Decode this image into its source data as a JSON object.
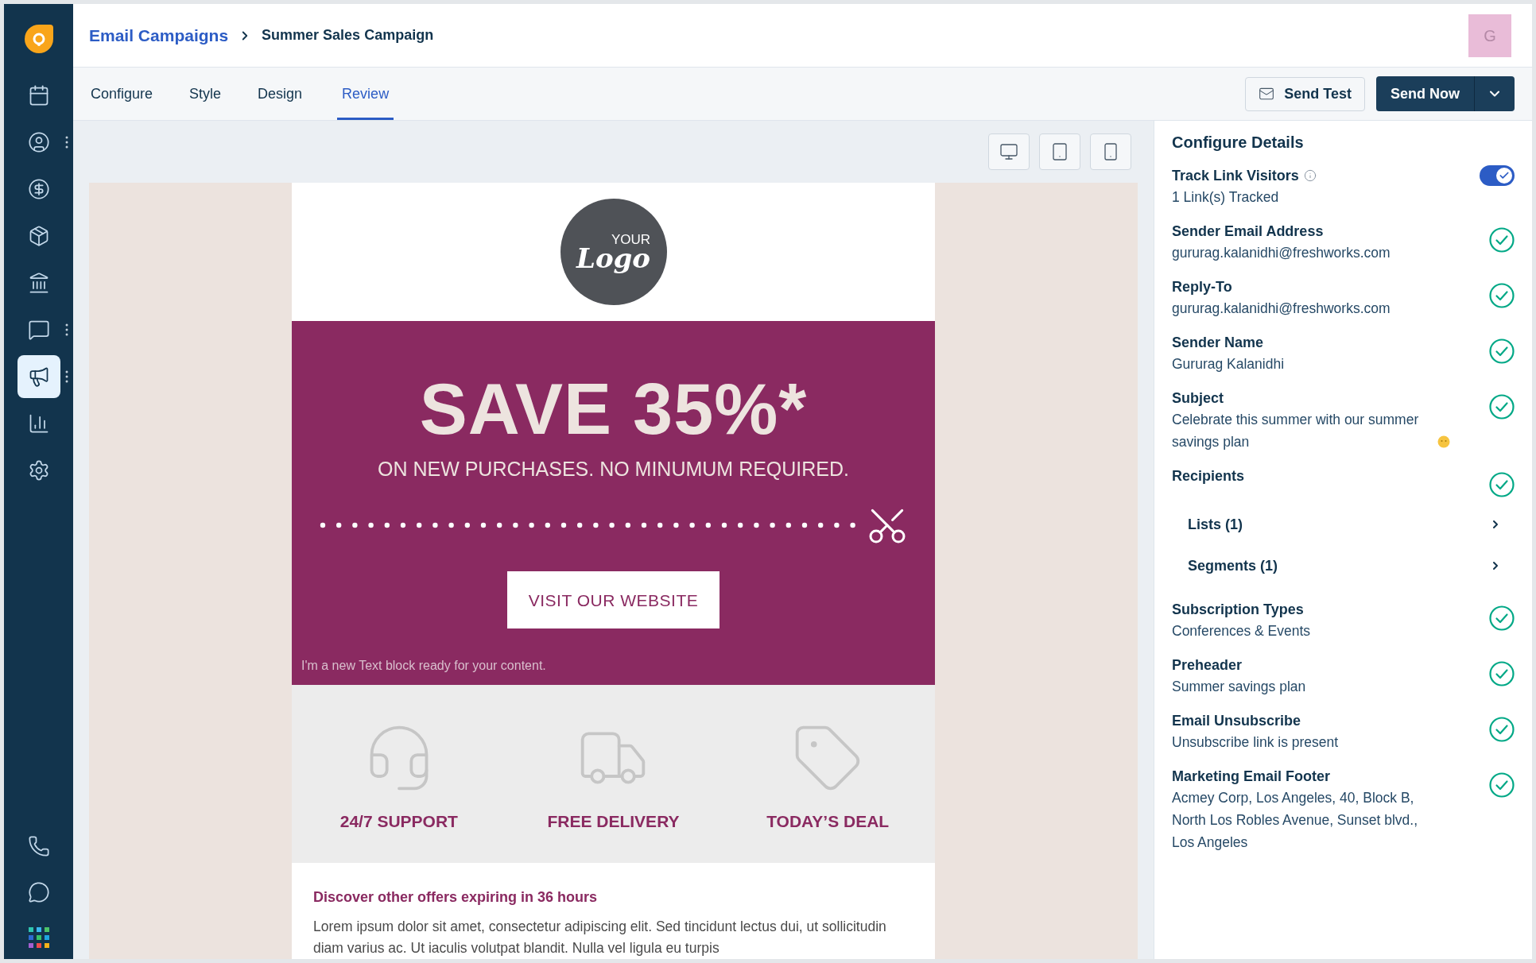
{
  "sidebar": {
    "items": [
      {
        "selected": false,
        "menu": false
      },
      {
        "selected": false,
        "menu": true
      },
      {
        "selected": false,
        "menu": false
      },
      {
        "selected": false,
        "menu": false
      },
      {
        "selected": false,
        "menu": false
      },
      {
        "selected": false,
        "menu": true
      },
      {
        "selected": true,
        "menu": true
      },
      {
        "selected": false,
        "menu": false
      },
      {
        "selected": false,
        "menu": false
      }
    ]
  },
  "header": {
    "breadcrumb": {
      "parent": "Email Campaigns",
      "current": "Summer Sales Campaign"
    },
    "avatar": {
      "initial": "G"
    }
  },
  "tabs": [
    {
      "label": "Configure",
      "selected": false
    },
    {
      "label": "Style",
      "selected": false
    },
    {
      "label": "Design",
      "selected": false
    },
    {
      "label": "Review",
      "selected": true
    }
  ],
  "actions": {
    "send_test": "Send Test",
    "send_now": "Send Now"
  },
  "email": {
    "logo": {
      "top": "YOUR",
      "script": "Logo"
    },
    "hero": {
      "headline": "SAVE 35%*",
      "subline": "ON NEW PURCHASES. NO MINUMUM REQUIRED.",
      "button": "VISIT OUR WEBSITE",
      "note": "I'm a new Text block ready for your content."
    },
    "features": [
      {
        "label": "24/7 SUPPORT"
      },
      {
        "label": "FREE DELIVERY"
      },
      {
        "label": "TODAY’S DEAL"
      }
    ],
    "offer": {
      "heading": "Discover other offers expiring in 36 hours",
      "body": "Lorem ipsum dolor sit amet, consectetur adipiscing elit. Sed tincidunt lectus dui, ut sollicitudin diam varius ac. Ut iaculis volutpat blandit. Nulla vel ligula eu turpis"
    }
  },
  "panel": {
    "title": "Configure Details",
    "items": [
      {
        "kind": "toggle",
        "label": "Track Link Visitors",
        "value": "1 Link(s) Tracked",
        "on": true
      },
      {
        "kind": "check",
        "label": "Sender Email Address",
        "value": "gururag.kalanidhi@freshworks.com",
        "checked": true
      },
      {
        "kind": "check",
        "label": "Reply-To",
        "value": "gururag.kalanidhi@freshworks.com",
        "checked": true
      },
      {
        "kind": "check",
        "label": "Sender Name",
        "value": "Gururag Kalanidhi",
        "checked": true
      },
      {
        "kind": "check",
        "label": "Subject",
        "value": "Celebrate this summer with our summer savings plan",
        "emoji": true,
        "checked": true
      },
      {
        "kind": "group",
        "label": "Recipients",
        "checked": true,
        "children": [
          {
            "label": "Lists (1)"
          },
          {
            "label": "Segments (1)"
          }
        ]
      },
      {
        "kind": "check",
        "label": "Subscription Types",
        "value": "Conferences & Events",
        "checked": true
      },
      {
        "kind": "check",
        "label": "Preheader",
        "value": "Summer savings plan",
        "checked": true
      },
      {
        "kind": "check",
        "label": "Email Unsubscribe",
        "value": "Unsubscribe link is present",
        "checked": true
      },
      {
        "kind": "check",
        "label": "Marketing Email Footer",
        "value": "Acmey Corp, Los Angeles, 40, Block B, North Los Robles Avenue, Sunset blvd., Los Angeles",
        "checked": true
      }
    ]
  }
}
